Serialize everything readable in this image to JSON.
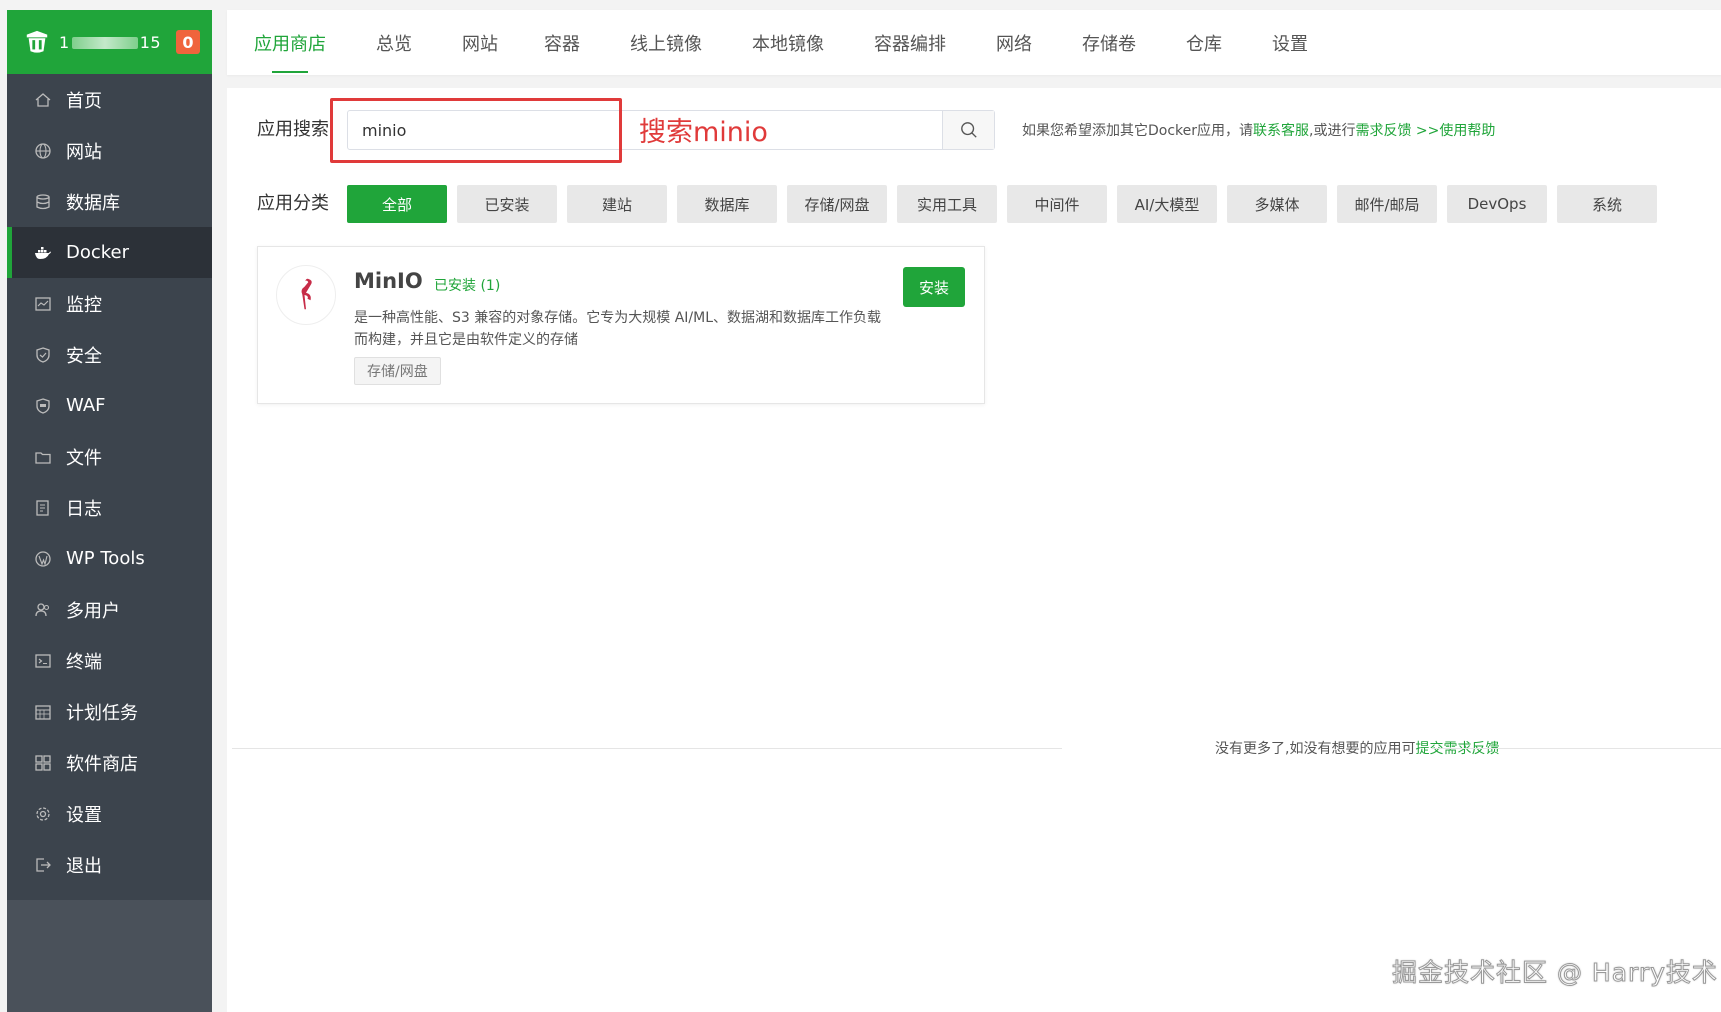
{
  "brand": {
    "server_prefix": "1",
    "server_suffix": "15",
    "badge": "0"
  },
  "sidebar": {
    "items": [
      {
        "label": "首页",
        "icon": "home-icon"
      },
      {
        "label": "网站",
        "icon": "globe-icon"
      },
      {
        "label": "数据库",
        "icon": "database-icon"
      },
      {
        "label": "Docker",
        "icon": "docker-icon"
      },
      {
        "label": "监控",
        "icon": "monitor-icon"
      },
      {
        "label": "安全",
        "icon": "shield-icon"
      },
      {
        "label": "WAF",
        "icon": "waf-shield-icon"
      },
      {
        "label": "文件",
        "icon": "folder-icon"
      },
      {
        "label": "日志",
        "icon": "log-icon"
      },
      {
        "label": "WP Tools",
        "icon": "wordpress-icon"
      },
      {
        "label": "多用户",
        "icon": "users-icon"
      },
      {
        "label": "终端",
        "icon": "terminal-icon"
      },
      {
        "label": "计划任务",
        "icon": "calendar-icon"
      },
      {
        "label": "软件商店",
        "icon": "apps-icon"
      },
      {
        "label": "设置",
        "icon": "gear-icon"
      },
      {
        "label": "退出",
        "icon": "logout-icon"
      }
    ],
    "active_index": 3
  },
  "tabs": [
    "应用商店",
    "总览",
    "网站",
    "容器",
    "线上镜像",
    "本地镜像",
    "容器编排",
    "网络",
    "存储卷",
    "仓库",
    "设置"
  ],
  "search": {
    "label": "应用搜索",
    "value": "minio",
    "annotation": "搜索minio",
    "help_prefix": "如果您希望添加其它Docker应用，请",
    "help_link1": "联系客服",
    "help_mid": ",或进行",
    "help_link2": "需求反馈",
    "help_arrow": " >>",
    "help_link3": "使用帮助"
  },
  "category": {
    "label": "应用分类",
    "items": [
      "全部",
      "已安装",
      "建站",
      "数据库",
      "存储/网盘",
      "实用工具",
      "中间件",
      "AI/大模型",
      "多媒体",
      "邮件/邮局",
      "DevOps",
      "系统"
    ]
  },
  "app": {
    "name": "MinIO",
    "installed": "已安装 (1)",
    "description": "是一种高性能、S3 兼容的对象存储。它专为大规模 AI/ML、数据湖和数据库工作负载而构建，并且它是由软件定义的存储",
    "tag": "存储/网盘",
    "install_label": "安装"
  },
  "footer": {
    "text": "没有更多了,如没有想要的应用可",
    "link": "提交需求反馈"
  },
  "watermark": "掘金技术社区 @ Harry技术",
  "colors": {
    "accent": "#20a53a",
    "sidebar_bg": "#3c444d",
    "annotation": "#e03a3a"
  }
}
